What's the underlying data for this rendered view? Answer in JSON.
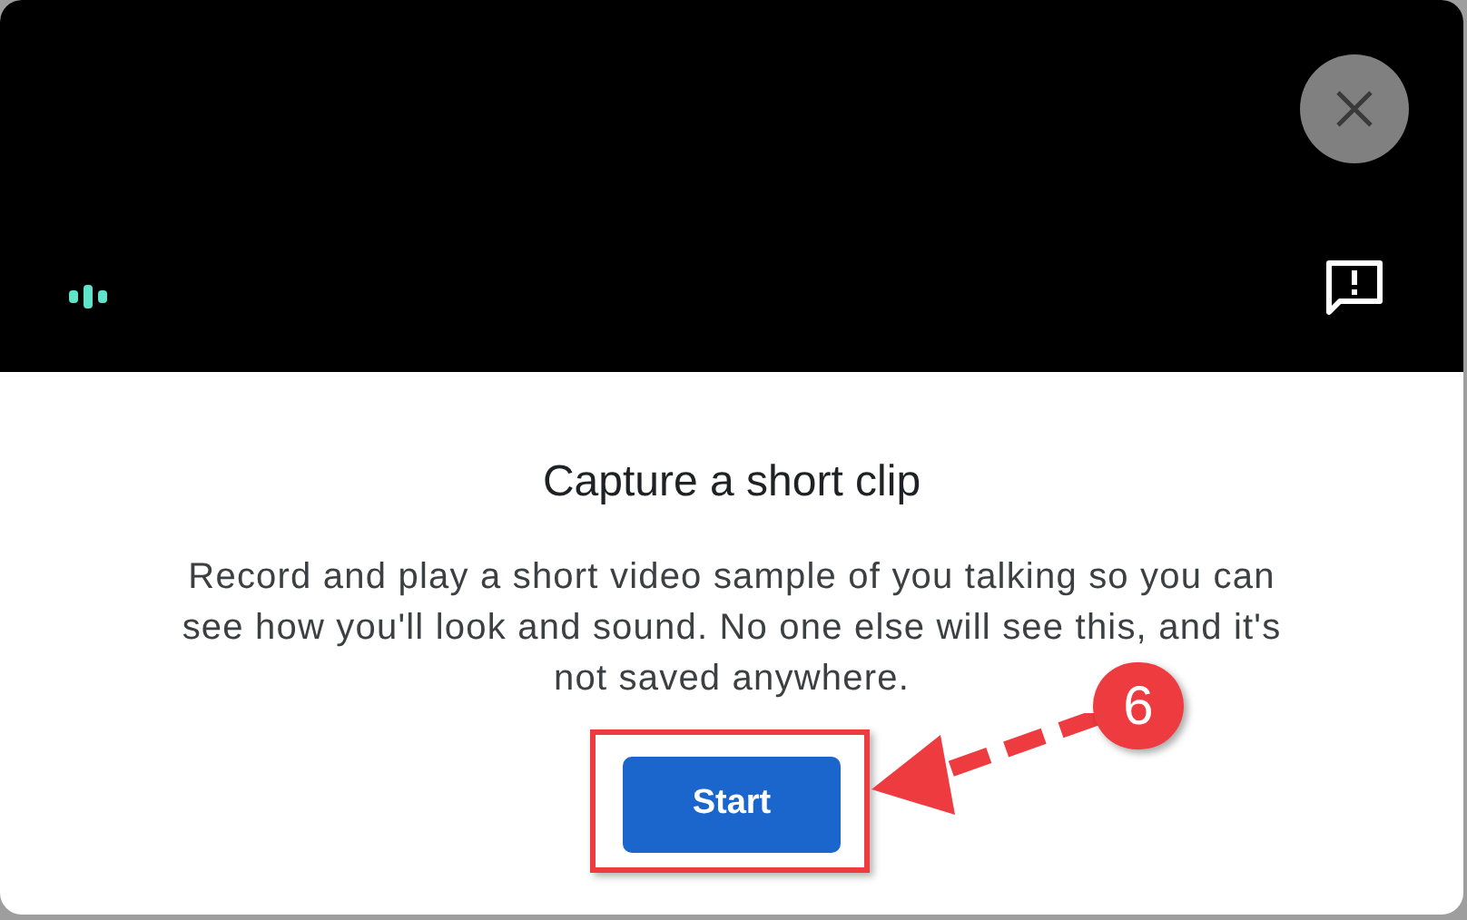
{
  "dialog": {
    "title": "Capture a short clip",
    "description": "Record and play a short video sample of you talking so you can see how you'll look and sound. No one else will see this, and it's not saved anywhere.",
    "primary_button": "Start"
  },
  "annotation": {
    "step": "6"
  }
}
